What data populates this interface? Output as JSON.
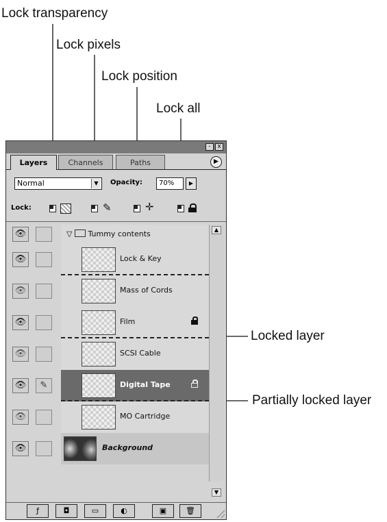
{
  "callouts": {
    "lock_transparency": "Lock transparency",
    "lock_pixels": "Lock pixels",
    "lock_position": "Lock position",
    "lock_all": "Lock all",
    "locked_layer": "Locked layer",
    "partially_locked_layer": "Partially locked layer"
  },
  "window": {
    "minimize": "-",
    "close": "x"
  },
  "tabs": [
    {
      "label": "Layers",
      "active": true
    },
    {
      "label": "Channels",
      "active": false
    },
    {
      "label": "Paths",
      "active": false
    }
  ],
  "menu_arrow": "▶",
  "blend_mode": {
    "value": "Normal"
  },
  "opacity": {
    "label": "Opacity:",
    "value": "70%"
  },
  "lock": {
    "label": "Lock:",
    "icons": [
      "transparency-icon",
      "brush-icon",
      "move-icon",
      "lock-icon"
    ]
  },
  "layers": [
    {
      "name": "Tummy contents",
      "type": "group"
    },
    {
      "name": "Lock & Key",
      "visible": true
    },
    {
      "name": "Mass of Cords",
      "visible": false
    },
    {
      "name": "Film",
      "visible": true,
      "lock": "full"
    },
    {
      "name": "SCSI Cable",
      "visible": false
    },
    {
      "name": "Digital Tape",
      "visible": true,
      "selected": true,
      "linked": true,
      "lock": "partial"
    },
    {
      "name": "MO Cartridge",
      "visible": false
    },
    {
      "name": "Background",
      "visible": true,
      "background": true
    }
  ],
  "bottom_buttons": [
    "layer-style-icon",
    "mask-icon",
    "new-set-icon",
    "adjustment-layer-icon",
    "new-layer-icon",
    "trash-icon"
  ]
}
